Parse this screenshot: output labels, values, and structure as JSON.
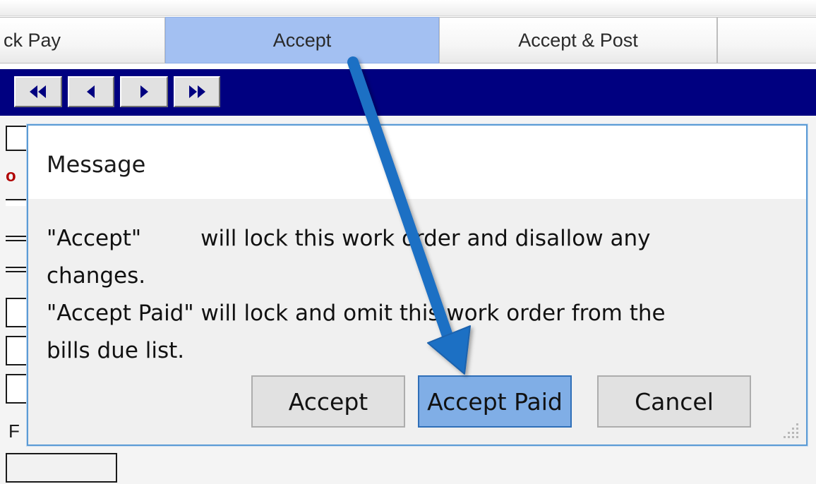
{
  "tabs": [
    {
      "label": "ck Pay",
      "active": false
    },
    {
      "label": "Accept",
      "active": true
    },
    {
      "label": "Accept & Post",
      "active": false
    }
  ],
  "navigator": {
    "buttons": [
      {
        "icon": "double-left-arrow-icon"
      },
      {
        "icon": "left-arrow-icon"
      },
      {
        "icon": "right-arrow-icon"
      },
      {
        "icon": "double-right-arrow-icon"
      }
    ]
  },
  "background_form": {
    "red_label": "o",
    "field_label": "F"
  },
  "dialog": {
    "title": "Message",
    "message": {
      "line1_term": "\"Accept\"",
      "line1_rest": "will lock this work order and disallow any",
      "line2": "changes.",
      "line3": "\"Accept Paid\" will lock and omit this work order from the",
      "line4": "bills due list."
    },
    "buttons": {
      "accept": "Accept",
      "accept_paid": "Accept Paid",
      "cancel": "Cancel"
    },
    "focused_button": "accept_paid"
  },
  "colors": {
    "active_tab": "#a3c0f2",
    "navigator_bar": "#000080",
    "dialog_border": "#5b9bd5",
    "focused_button": "#80aee6",
    "annotation_arrow": "#1f6fc4"
  }
}
